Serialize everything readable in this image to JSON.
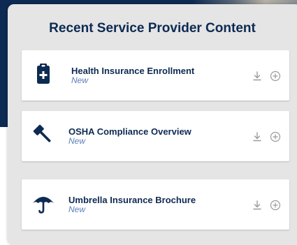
{
  "panel": {
    "title": "Recent Service Provider Content"
  },
  "items": [
    {
      "name": "Health Insurance Enrollment",
      "status": "New",
      "icon": "medical-clipboard-icon"
    },
    {
      "name": "OSHA Compliance Overview",
      "status": "New",
      "icon": "gavel-icon"
    },
    {
      "name": "Umbrella Insurance Brochure",
      "status": "New",
      "icon": "umbrella-icon"
    }
  ],
  "colors": {
    "navy": "#0d2a52",
    "status_blue": "#5b7fb8",
    "panel_bg": "#e5e5e5",
    "action_gray": "#9a9a9a"
  }
}
